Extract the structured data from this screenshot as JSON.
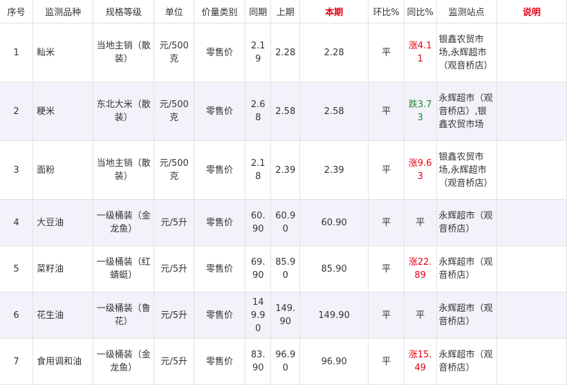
{
  "headers": [
    "序号",
    "监测品种",
    "规格等级",
    "单位",
    "价量类别",
    "同期",
    "上期",
    "本期",
    "环比%",
    "同比%",
    "监测站点",
    "说明"
  ],
  "rows": [
    {
      "no": "1",
      "name": "籼米",
      "spec": "当地主销（散装）",
      "unit": "元/500克",
      "type": "零售价",
      "same": "2.19",
      "prev": "2.28",
      "cur": "2.28",
      "mom": "平",
      "yoy": "涨4.11",
      "yoy_dir": "up",
      "stations": "银鑫农贸市场,永辉超市（观音桥店）",
      "note": ""
    },
    {
      "no": "2",
      "name": "粳米",
      "spec": "东北大米（散装）",
      "unit": "元/500克",
      "type": "零售价",
      "same": "2.68",
      "prev": "2.58",
      "cur": "2.58",
      "mom": "平",
      "yoy": "跌3.73",
      "yoy_dir": "down",
      "stations": "永辉超市（观音桥店）,银鑫农贸市场",
      "note": ""
    },
    {
      "no": "3",
      "name": "面粉",
      "spec": "当地主销（散装）",
      "unit": "元/500克",
      "type": "零售价",
      "same": "2.18",
      "prev": "2.39",
      "cur": "2.39",
      "mom": "平",
      "yoy": "涨9.63",
      "yoy_dir": "up",
      "stations": "银鑫农贸市场,永辉超市（观音桥店）",
      "note": ""
    },
    {
      "no": "4",
      "name": "大豆油",
      "spec": "一级桶装（金龙鱼）",
      "unit": "元/5升",
      "type": "零售价",
      "same": "60.90",
      "prev": "60.90",
      "cur": "60.90",
      "mom": "平",
      "yoy": "平",
      "yoy_dir": "flat",
      "stations": "永辉超市（观音桥店）",
      "note": ""
    },
    {
      "no": "5",
      "name": "菜籽油",
      "spec": "一级桶装（红蜻蜓）",
      "unit": "元/5升",
      "type": "零售价",
      "same": "69.90",
      "prev": "85.90",
      "cur": "85.90",
      "mom": "平",
      "yoy": "涨22.89",
      "yoy_dir": "up",
      "stations": "永辉超市（观音桥店）",
      "note": ""
    },
    {
      "no": "6",
      "name": "花生油",
      "spec": "一级桶装（鲁花）",
      "unit": "元/5升",
      "type": "零售价",
      "same": "149.90",
      "prev": "149.90",
      "cur": "149.90",
      "mom": "平",
      "yoy": "平",
      "yoy_dir": "flat",
      "stations": "永辉超市（观音桥店）",
      "note": ""
    },
    {
      "no": "7",
      "name": "食用调和油",
      "spec": "一级桶装（金龙鱼）",
      "unit": "元/5升",
      "type": "零售价",
      "same": "83.90",
      "prev": "96.90",
      "cur": "96.90",
      "mom": "平",
      "yoy": "涨15.49",
      "yoy_dir": "up",
      "stations": "永辉超市（观音桥店）",
      "note": ""
    }
  ]
}
